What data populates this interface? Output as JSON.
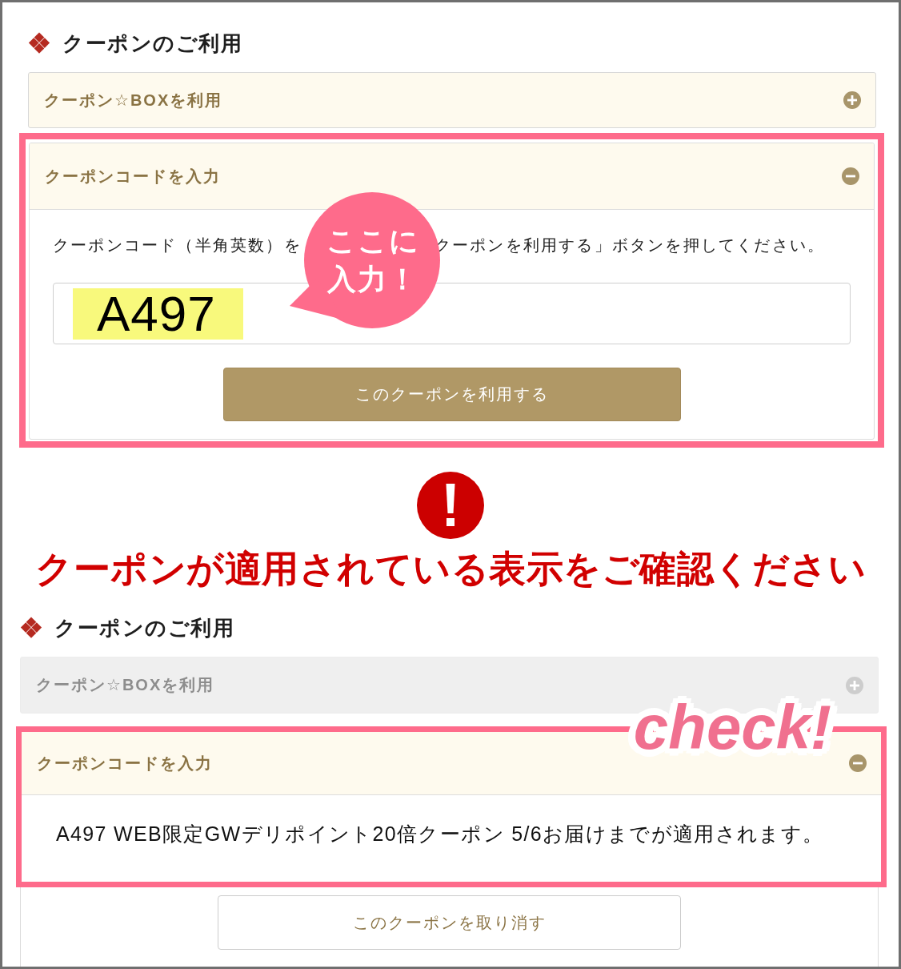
{
  "blocks": [
    {
      "kind": "section",
      "heading": "クーポンのご利用",
      "accordions": [
        {
          "title": "クーポン☆BOXを利用",
          "expanded": false,
          "disabled": false,
          "framed": false
        },
        {
          "title": "クーポンコードを入力",
          "expanded": true,
          "disabled": false,
          "framed": true,
          "callout": [
            "ここに",
            "入力！"
          ],
          "body": [
            {
              "kind": "instruction",
              "parts": [
                "クーポンコード（半角英数）を",
                "クーポンを利用する」ボタンを押してください。"
              ],
              "framed": true
            },
            {
              "kind": "input",
              "value": "A497",
              "marked": true,
              "framed": true
            },
            {
              "kind": "primary",
              "label": "このクーポンを利用する",
              "framed": true
            }
          ]
        }
      ]
    },
    {
      "kind": "notice",
      "text": "クーポンが適用されている表示をご確認ください"
    },
    {
      "kind": "section",
      "heading": "クーポンのご利用",
      "accordions": [
        {
          "title": "クーポン☆BOXを利用",
          "expanded": false,
          "disabled": true,
          "framed": false
        },
        {
          "title": "クーポンコードを入力",
          "expanded": true,
          "disabled": false,
          "framed": true,
          "stamp": "check!",
          "body": [
            {
              "kind": "message",
              "text": "A497 WEB限定GWデリポイント20倍クーポン 5/6お届けまでが適用されます。",
              "framed": true
            },
            {
              "kind": "secondary",
              "label": "このクーポンを取り消す",
              "framed": false
            }
          ]
        }
      ]
    }
  ]
}
